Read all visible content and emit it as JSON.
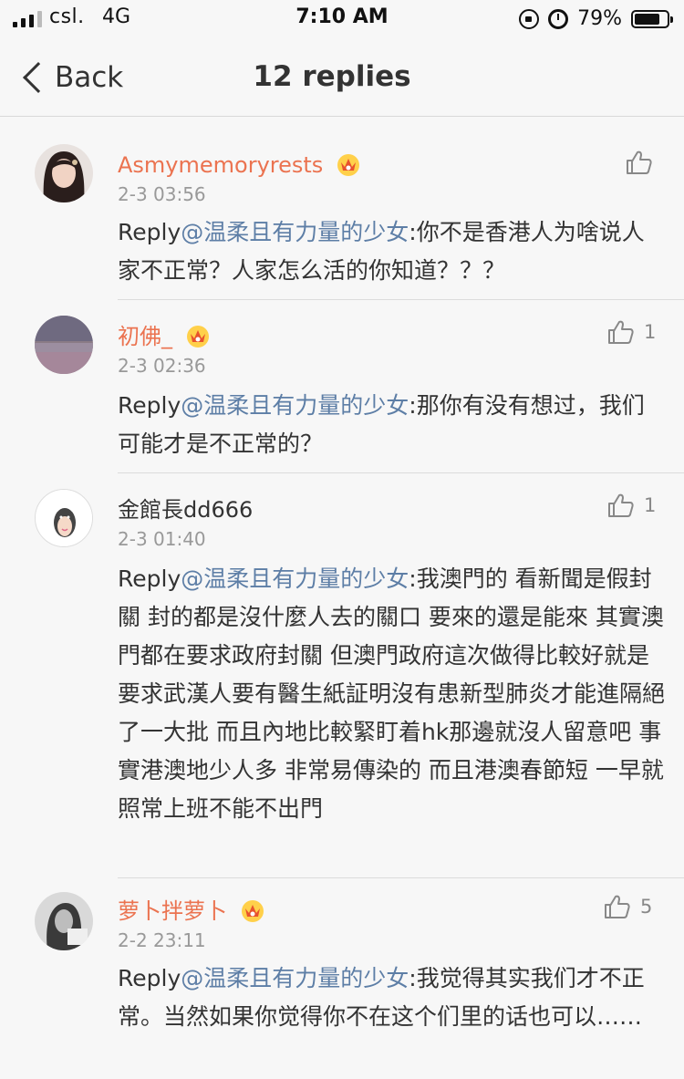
{
  "status_bar": {
    "carrier": "csl.",
    "network": "4G",
    "time": "7:10 AM",
    "battery_percent": "79%",
    "battery_level": 0.79,
    "icons": [
      "signal-icon",
      "rotation-lock-icon",
      "alarm-icon",
      "battery-icon"
    ]
  },
  "nav": {
    "back_label": "Back",
    "title": "12 replies"
  },
  "colors": {
    "username_vip": "#eb7350",
    "mention": "#5d7ea6",
    "timestamp": "#999999",
    "background": "#f7f7f7"
  },
  "comments": [
    {
      "username": "Asmymemoryrests",
      "vip_badge": "crown-icon",
      "time": "2-3 03:56",
      "reply_prefix": "Reply",
      "mention": "@温柔且有力量的少女",
      "text": ":你不是香港人为啥说人家不正常？人家怎么活的你知道？？？",
      "likes": ""
    },
    {
      "username": "初佛_",
      "vip_badge": "crown-icon",
      "time": "2-3 02:36",
      "reply_prefix": "Reply",
      "mention": "@温柔且有力量的少女",
      "text": ":那你有没有想过，我们可能才是不正常的？",
      "likes": "1"
    },
    {
      "username": "金館長dd666",
      "vip_badge": "",
      "time": "2-3 01:40",
      "reply_prefix": "Reply",
      "mention": "@温柔且有力量的少女",
      "text": ":我澳門的 看新聞是假封關 封的都是沒什麼人去的關口 要來的還是能來 其實澳門都在要求政府封關 但澳門政府這次做得比較好就是要求武漢人要有醫生紙証明沒有患新型肺炎才能進隔絕了一大批 而且內地比較緊盯着hk那邊就沒人留意吧 事實港澳地少人多 非常易傳染的 而且港澳春節短 一早就照常上班不能不出門",
      "likes": "1"
    },
    {
      "username": "萝卜拌萝卜",
      "vip_badge": "crown-icon",
      "time": "2-2 23:11",
      "reply_prefix": "Reply",
      "mention": "@温柔且有力量的少女",
      "text": ":我觉得其实我们才不正常。当然如果你觉得你不在这个们里的话也可以……",
      "likes": "5"
    }
  ]
}
